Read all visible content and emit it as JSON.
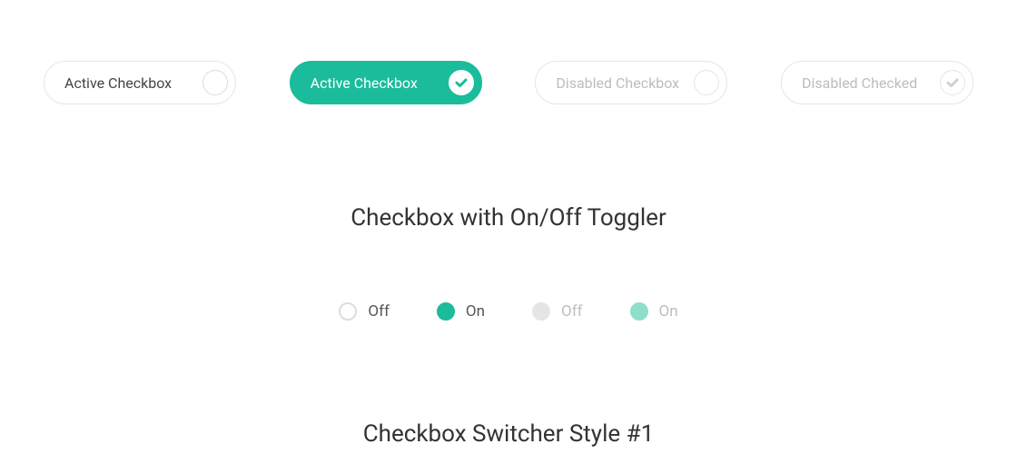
{
  "colors": {
    "accent": "#1abc9c",
    "text": "#333333",
    "muted": "#bdbdbd",
    "border": "#e5e5e5"
  },
  "checkbox_row": [
    {
      "label": "Active Checkbox",
      "checked": false,
      "disabled": false
    },
    {
      "label": "Active Checkbox",
      "checked": true,
      "disabled": false
    },
    {
      "label": "Disabled Checkbox",
      "checked": false,
      "disabled": true
    },
    {
      "label": "Disabled Checked",
      "checked": true,
      "disabled": true
    }
  ],
  "headings": {
    "toggler": "Checkbox with On/Off Toggler",
    "switcher": "Checkbox Switcher Style #1"
  },
  "togglers": [
    {
      "label": "Off",
      "on": false,
      "disabled": false
    },
    {
      "label": "On",
      "on": true,
      "disabled": false
    },
    {
      "label": "Off",
      "on": false,
      "disabled": true
    },
    {
      "label": "On",
      "on": true,
      "disabled": true
    }
  ]
}
